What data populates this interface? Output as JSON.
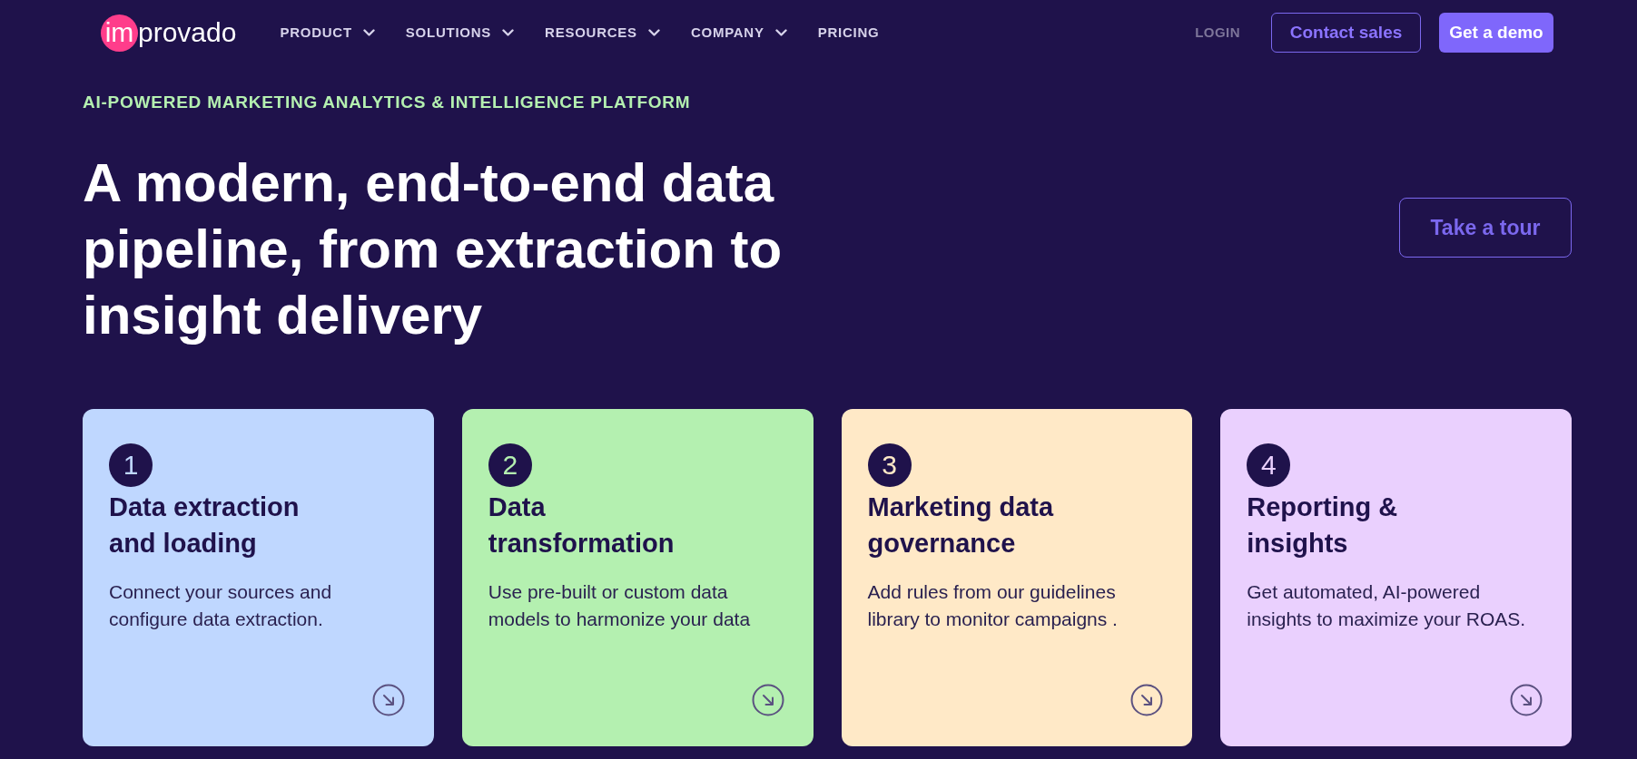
{
  "header": {
    "logo": {
      "badge": "im",
      "text": "provado"
    },
    "nav": [
      {
        "label": "PRODUCT",
        "dropdown": true
      },
      {
        "label": "SOLUTIONS",
        "dropdown": true
      },
      {
        "label": "RESOURCES",
        "dropdown": true
      },
      {
        "label": "COMPANY",
        "dropdown": true
      },
      {
        "label": "PRICING",
        "dropdown": false
      }
    ],
    "actions": [
      {
        "label": "LOGIN",
        "kind": "link"
      },
      {
        "label": "Contact sales",
        "kind": "outline"
      },
      {
        "label": "Get a demo",
        "kind": "primary"
      }
    ]
  },
  "hero": {
    "eyebrow": "AI-POWERED MARKETING ANALYTICS & INTELLIGENCE PLATFORM",
    "title": "A modern, end-to-end data pipeline, from extraction to insight delivery",
    "tour_button": "Take a tour"
  },
  "steps": [
    {
      "number": "1",
      "title": "Data extraction and loading",
      "description": "Connect your sources and configure data extraction.",
      "color": "#bfd7ff"
    },
    {
      "number": "2",
      "title": "Data transformation",
      "description": "Use pre-built or custom data models to harmonize your data",
      "color": "#b4f0b0"
    },
    {
      "number": "3",
      "title": "Marketing data governance",
      "description": "Add rules from our guidelines library to monitor campaigns .",
      "color": "#ffe9c7"
    },
    {
      "number": "4",
      "title": "Reporting & insights",
      "description": "Get automated, AI-powered insights to maximize your ROAS.",
      "color": "#ead0fe"
    }
  ]
}
